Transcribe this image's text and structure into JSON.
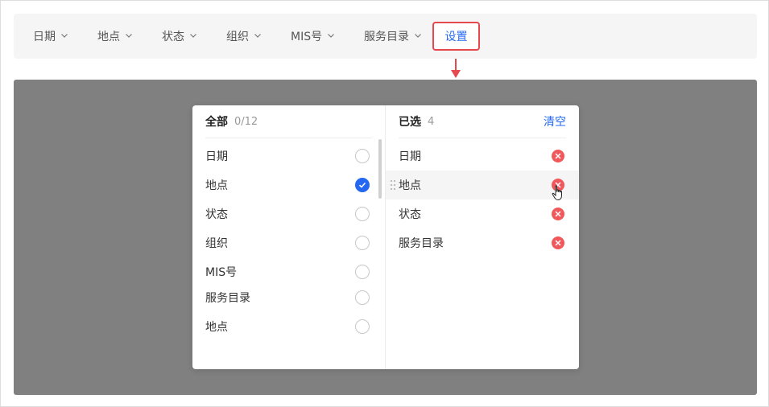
{
  "filters": [
    {
      "label": "日期",
      "icon": "chevron-down-icon"
    },
    {
      "label": "地点",
      "icon": "chevron-down-icon"
    },
    {
      "label": "状态",
      "icon": "chevron-down-icon"
    },
    {
      "label": "组织",
      "icon": "chevron-down-icon"
    },
    {
      "label": "MIS号",
      "icon": "chevron-down-icon"
    },
    {
      "label": "服务目录",
      "icon": "chevron-down-icon"
    }
  ],
  "settings_label": "设置",
  "all": {
    "title": "全部",
    "count": "0/12",
    "items": [
      {
        "label": "日期",
        "checked": false
      },
      {
        "label": "地点",
        "checked": true
      },
      {
        "label": "状态",
        "checked": false
      },
      {
        "label": "组织",
        "checked": false
      },
      {
        "label": "MIS号",
        "checked": false
      },
      {
        "label": "服务目录",
        "checked": false
      },
      {
        "label": "地点",
        "checked": false
      }
    ]
  },
  "selected": {
    "title": "已选",
    "count": "4",
    "clear_label": "清空",
    "items": [
      {
        "label": "日期"
      },
      {
        "label": "地点"
      },
      {
        "label": "状态"
      },
      {
        "label": "服务目录"
      }
    ]
  },
  "colors": {
    "accent": "#2468f2",
    "danger": "#f0585c",
    "highlight_border": "#e5484d",
    "overlay": "#808080"
  }
}
